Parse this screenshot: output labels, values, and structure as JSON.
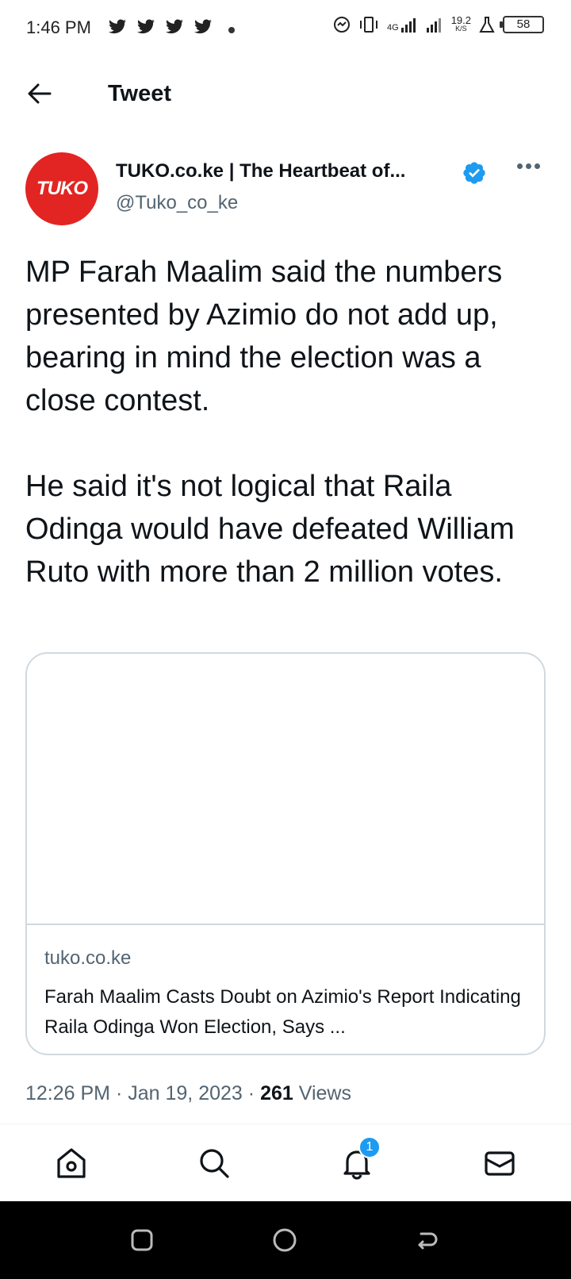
{
  "status_bar": {
    "time": "1:46 PM",
    "net_speed_value": "19.2",
    "net_speed_unit": "K/S",
    "network_type": "4G",
    "battery": "58"
  },
  "header": {
    "title": "Tweet"
  },
  "tweet": {
    "author_name": "TUKO.co.ke | The Heartbeat of...",
    "author_handle": "@Tuko_co_ke",
    "avatar_text": "TUKO",
    "paragraphs": [
      "MP Farah Maalim said the numbers presented by Azimio do not add up, bearing in mind the election was a close contest.",
      "He said it's not logical that Raila Odinga would have defeated William Ruto with more than 2 million votes."
    ],
    "link_card": {
      "domain": "tuko.co.ke",
      "title": "Farah Maalim Casts Doubt on Azimio's Report Indicating Raila Odinga Won Election, Says ..."
    },
    "time": "12:26 PM",
    "date": "Jan 19, 2023",
    "separator": "·",
    "views_count": "261",
    "views_label": "Views"
  },
  "bottom_nav": {
    "notification_badge": "1"
  },
  "colors": {
    "accent": "#1d9bf0",
    "avatar_bg": "#e22522",
    "secondary_text": "#536471"
  }
}
